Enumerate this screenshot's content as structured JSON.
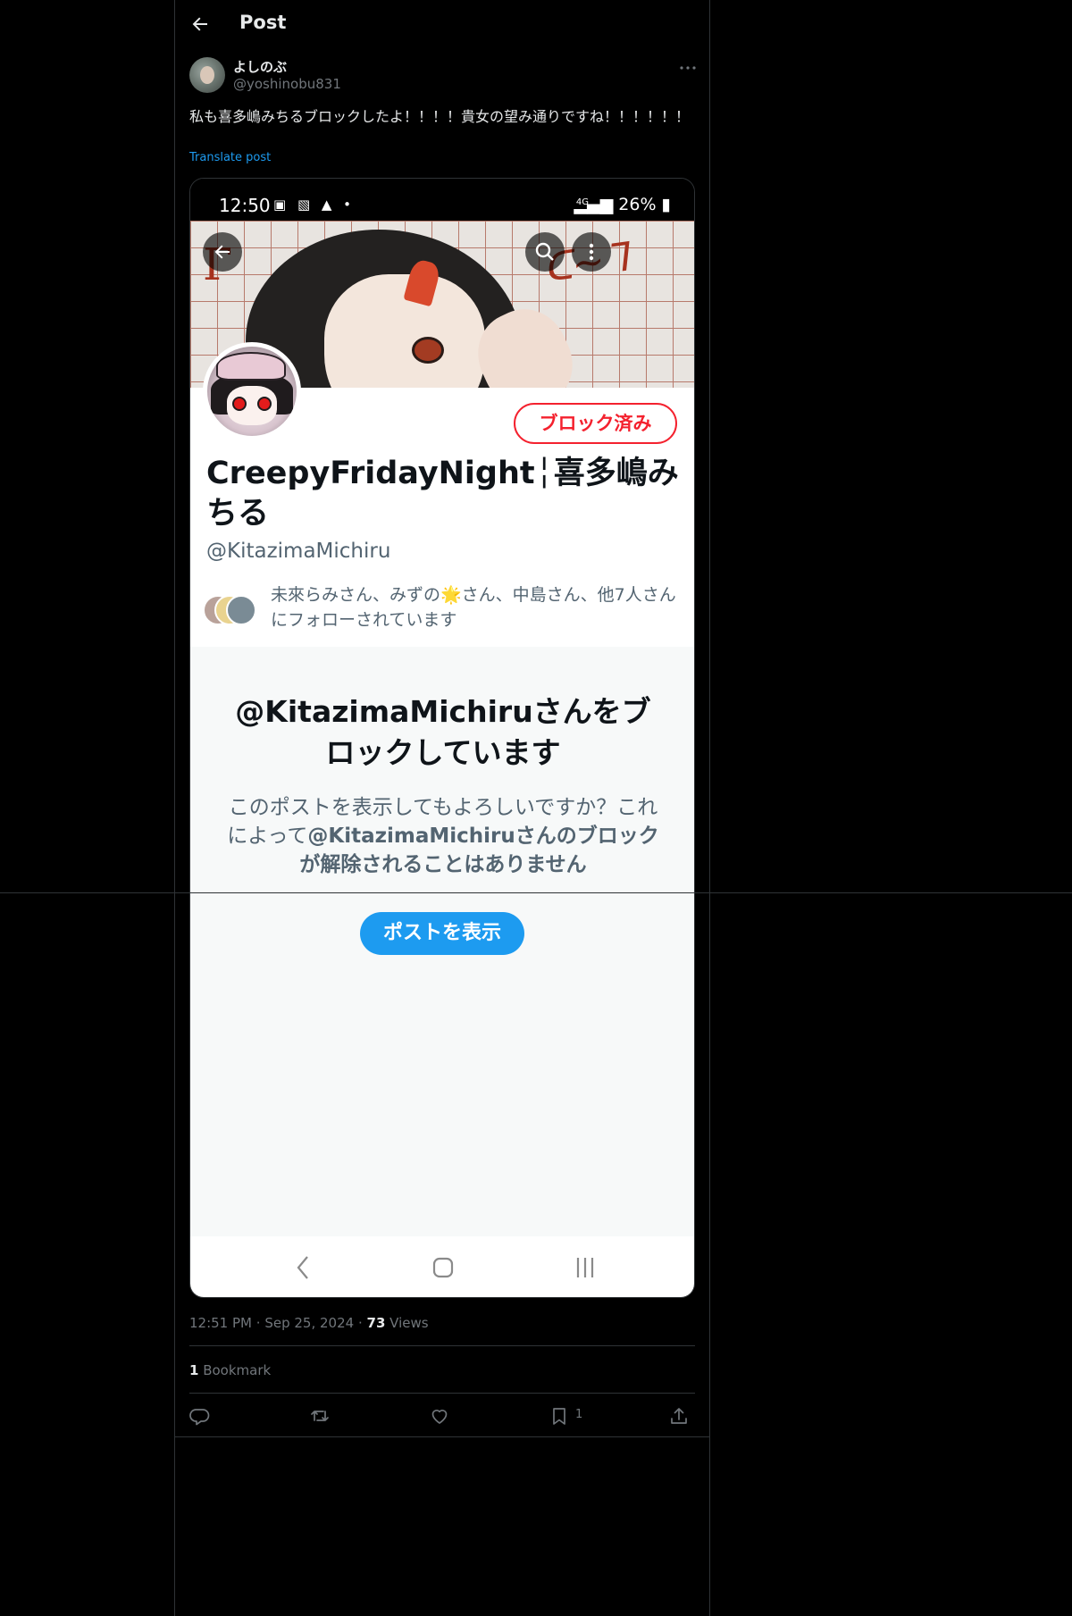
{
  "header": {
    "title": "Post"
  },
  "author": {
    "display_name": "よしのぶ",
    "handle": "@yoshinobu831"
  },
  "post": {
    "text": "私も喜多嶋みちるブロックしたよ！！！！貴女の望み通りですね！！！！！！",
    "translate_label": "Translate post"
  },
  "screenshot": {
    "status_bar": {
      "time": "12:50",
      "network": "4G",
      "battery": "26%"
    },
    "profile": {
      "blocked_label": "ブロック済み",
      "name": "CreepyFridayNight╎喜多嶋みちる",
      "handle": "@KitazimaMichiru",
      "followed_by": "未來らみさん、みずの🌟さん、中島さん、他7人さんにフォローされています"
    },
    "block_notice": {
      "title": "@KitazimaMichiruさんをブロックしています",
      "description_prefix": "このポストを表示してもよろしいですか？これによって",
      "description_bold": "@KitazimaMichiruさんのブロックが解除されることはありません",
      "button_label": "ポストを表示"
    }
  },
  "meta": {
    "time": "12:51 PM",
    "separator": "·",
    "date": "Sep 25, 2024",
    "views_count": "73",
    "views_label": "Views"
  },
  "bookmarks": {
    "count": "1",
    "label": "Bookmark"
  },
  "actions": {
    "reply_icon": "reply-icon",
    "repost_icon": "repost-icon",
    "like_icon": "heart-icon",
    "bookmark_icon": "bookmark-icon",
    "bookmark_count": "1",
    "share_icon": "share-icon"
  },
  "colors": {
    "background": "#000000",
    "accent": "#1d9bf0",
    "blocked_red": "#f4212e",
    "muted_text": "#71767b"
  }
}
